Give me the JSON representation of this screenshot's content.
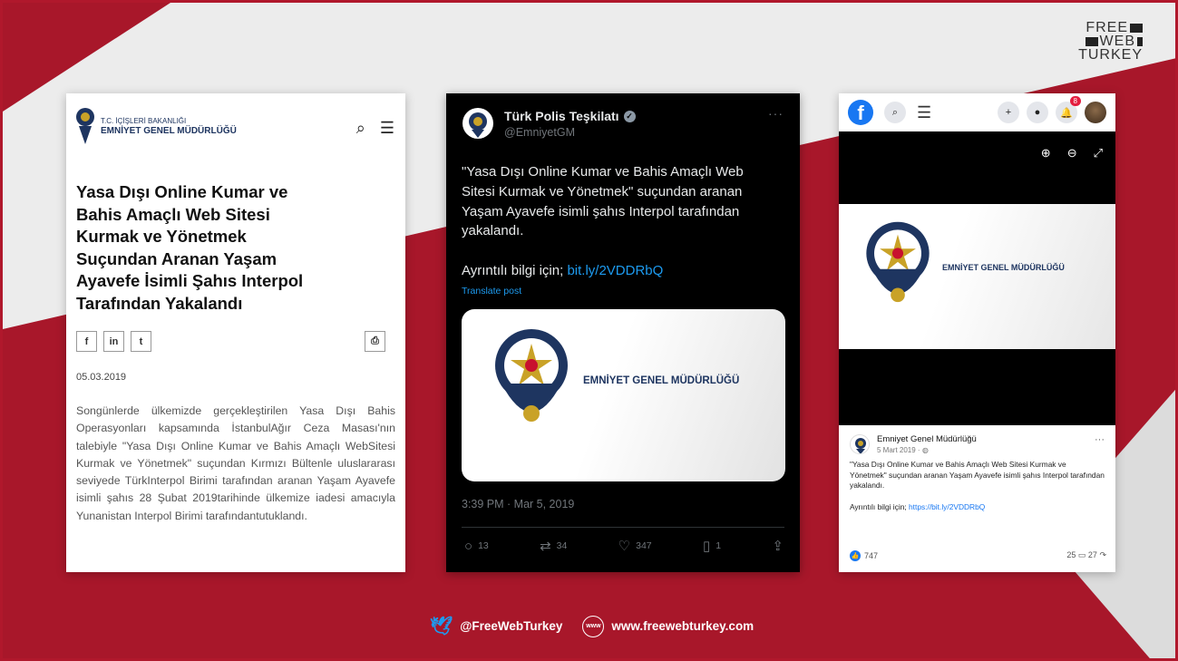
{
  "brand": {
    "line1": "FREE",
    "line2": "WEB",
    "line3": "TURKEY"
  },
  "panel1": {
    "org_top": "T.C. İÇİŞLERİ BAKANLIĞI",
    "org_name": "EMNİYET GENEL MÜDÜRLÜĞÜ",
    "title": "Yasa Dışı Online Kumar ve Bahis Amaçlı Web Sitesi Kurmak ve Yönetmek Suçundan Aranan Yaşam Ayavefe İsimli Şahıs Interpol Tarafından Yakalandı",
    "share": [
      "f",
      "in",
      "t"
    ],
    "date": "05.03.2019",
    "body": "Songünlerde ülkemizde gerçekleştirilen Yasa Dışı Bahis Operasyonları kapsamında İstanbulAğır Ceza Masası'nın talebiyle \"Yasa Dışı Online Kumar ve Bahis Amaçlı WebSitesi Kurmak ve Yönetmek\" suçundan Kırmızı Bültenle uluslararası seviyede TürkInterpol Birimi tarafından aranan Yaşam Ayavefe isimli şahıs 28 Şubat 2019tarihinde ülkemize iadesi amacıyla Yunanistan Interpol Birimi tarafındantutuklandı."
  },
  "tweet": {
    "name": "Türk Polis Teşkilatı",
    "handle": "@EmniyetGM",
    "more": "···",
    "text": "\"Yasa Dışı Online Kumar ve Bahis Amaçlı Web Sitesi Kurmak ve Yönetmek\" suçundan aranan Yaşam Ayavefe isimli şahıs Interpol tarafından yakalandı.",
    "info_label": "Ayrıntılı bilgi için;",
    "link": "bit.ly/2VDDRbQ",
    "translate": "Translate post",
    "card_text": "EMNİYET GENEL MÜDÜRLÜĞÜ",
    "time": "3:39 PM · Mar 5, 2019",
    "replies": "13",
    "retweets": "34",
    "likes": "347",
    "bookmarks": "1"
  },
  "facebook": {
    "notif_count": "8",
    "image_text": "EMNİYET GENEL MÜDÜRLÜĞÜ",
    "page_name": "Emniyet Genel Müdürlüğü",
    "post_date": "5 Mart 2019 · ",
    "post_text": "\"Yasa Dışı Online Kumar ve Bahis Amaçlı Web Sitesi Kurmak ve Yönetmek\" suçundan aranan Yaşam Ayavefe isimli şahıs Interpol tarafından yakalandı.",
    "info_label": "Ayrıntılı bilgi için;",
    "link": "https://bit.ly/2VDDRbQ",
    "reactions": "747",
    "comments": "25",
    "shares": "27"
  },
  "footer": {
    "twitter": "@FreeWebTurkey",
    "www_icon": "www",
    "site": "www.freewebturkey.com"
  }
}
